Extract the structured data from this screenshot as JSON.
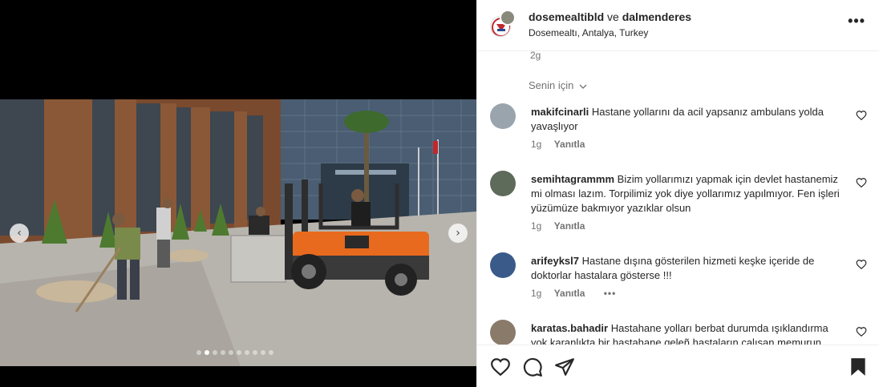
{
  "header": {
    "account_primary": "dosemealtibld",
    "and_word": "ve",
    "account_collab": "dalmenderes",
    "location": "Dosemealtı, Antalya, Turkey",
    "more_label": "•••"
  },
  "post": {
    "time_ago": "2g",
    "sort_label": "Senin için",
    "sort_icon": "chevron-down-icon"
  },
  "media": {
    "prev_label": "‹",
    "next_label": "›",
    "slide_count": 10,
    "active_slide": 2
  },
  "comments": [
    {
      "username": "makifcinarli",
      "text": "Hastane yollarını da acil yapsanız ambulans yolda yavaşlıyor",
      "time": "1g",
      "reply_label": "Yanıtla",
      "avatar_color": "#9aa4ad"
    },
    {
      "username": "semihtagrammm",
      "text": "Bizim yollarımızı yapmak için devlet hastanemiz mi olması lazım. Torpilimiz yok diye yollarımız yapılmıyor. Fen işleri yüzümüze bakmıyor yazıklar olsun",
      "time": "1g",
      "reply_label": "Yanıtla",
      "avatar_color": "#5e6a5a"
    },
    {
      "username": "arifeyksl7",
      "text": "Hastane dışına gösterilen hizmeti keşke içeride de doktorlar hastalara gösterse !!!",
      "time": "1g",
      "reply_label": "Yanıtla",
      "more_label": "•••",
      "avatar_color": "#3a5a8a"
    },
    {
      "username": "karatas.bahadir",
      "text": "Hastahane yolları berbat durumda ışıklandırma yok karanlıkta bir hastahane geleñ hastaların çalışan memurun",
      "avatar_color": "#8a7a6a"
    }
  ],
  "actions": {
    "like_icon": "heart-icon",
    "comment_icon": "comment-icon",
    "share_icon": "send-icon",
    "save_icon": "bookmark-icon"
  },
  "colors": {
    "text": "#262626",
    "muted": "#737373",
    "border": "#efefef",
    "forklift_orange": "#e86a1e"
  }
}
